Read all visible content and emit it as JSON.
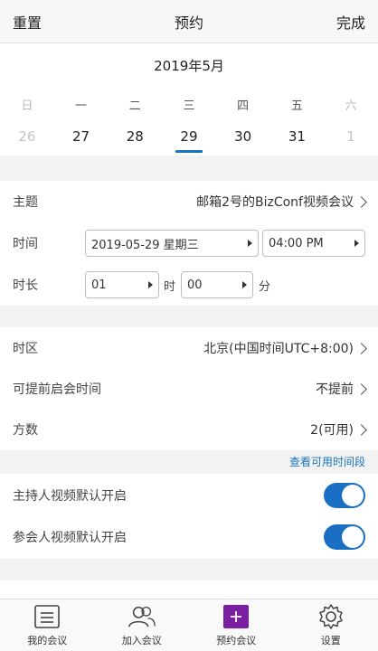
{
  "header": {
    "reset_label": "重置",
    "title": "预约",
    "done_label": "完成"
  },
  "calendar": {
    "month_label": "2019年5月",
    "weekdays": [
      "日",
      "一",
      "二",
      "三",
      "四",
      "五",
      "六"
    ],
    "days": [
      "26",
      "27",
      "28",
      "29",
      "30",
      "31",
      "1"
    ],
    "selected_day": "29"
  },
  "form": {
    "topic_label": "主题",
    "topic_value": "邮箱2号的BizConf视频会议",
    "time_label": "时间",
    "date_value": "2019-05-29 星期三",
    "time_value": "04:00 PM",
    "duration_label": "时长",
    "hours_value": "01",
    "hours_unit": "时",
    "minutes_value": "00",
    "minutes_unit": "分"
  },
  "settings": {
    "timezone_label": "时区",
    "timezone_value": "北京(中国时间UTC+8:00)",
    "early_start_label": "可提前启会时间",
    "early_start_value": "不提前",
    "parties_label": "方数",
    "parties_value": "2(可用)",
    "view_slots_link": "查看可用时间段"
  },
  "toggles": {
    "host_video_label": "主持人视频默认开启",
    "host_video_on": true,
    "participant_video_label": "参会人视频默认开启",
    "participant_video_on": true
  },
  "colors": {
    "accent": "#1a73b8",
    "toggle_on": "#1a6fc4",
    "active_tab": "#7b1fa2"
  },
  "tabs": [
    {
      "label": "我的会议",
      "icon": "list-icon"
    },
    {
      "label": "加入会议",
      "icon": "people-icon"
    },
    {
      "label": "预约会议",
      "icon": "plus-square-icon",
      "active": true
    },
    {
      "label": "设置",
      "icon": "gear-icon"
    }
  ]
}
